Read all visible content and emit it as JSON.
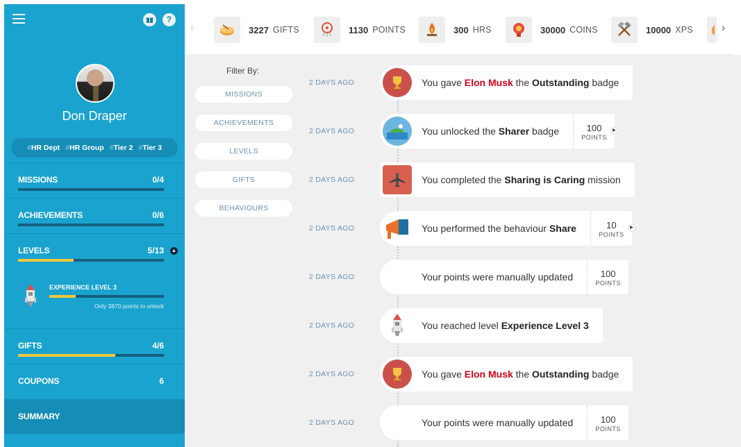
{
  "sidebar": {
    "user_name": "Don Draper",
    "tags": [
      "HR Dept",
      "HR Group",
      "Tier 2",
      "Tier 3"
    ],
    "tag_hash": "#",
    "help_icon": "?",
    "nav": [
      {
        "label": "MISSIONS",
        "value": "0/4",
        "progress": 0
      },
      {
        "label": "ACHIEVEMENTS",
        "value": "0/6",
        "progress": 0
      },
      {
        "label": "LEVELS",
        "value": "5/13",
        "progress": 0.38
      },
      {
        "label": "GIFTS",
        "value": "4/6",
        "progress": 0.667
      },
      {
        "label": "COUPONS",
        "value": "6"
      },
      {
        "label": "SUMMARY"
      }
    ],
    "level_detail": {
      "title": "EXPERIENCE LEVEL 3",
      "progress": 0.23,
      "hint": "Only 3870 points to unlock"
    }
  },
  "stats": [
    {
      "num": "3227",
      "unit": "GIFTS",
      "icon": "gift-drum-icon"
    },
    {
      "num": "1130",
      "unit": "POINTS",
      "icon": "dreamcatcher-icon"
    },
    {
      "num": "300",
      "unit": "HRS",
      "icon": "campfire-icon"
    },
    {
      "num": "30000",
      "unit": "COINS",
      "icon": "medal-icon"
    },
    {
      "num": "10000",
      "unit": "XPS",
      "icon": "crossed-tools-icon"
    }
  ],
  "filter": {
    "title": "Filter By:",
    "buttons": [
      "MISSIONS",
      "ACHIEVEMENTS",
      "LEVELS",
      "GIFTS",
      "BEHAVIOURS"
    ]
  },
  "feed": [
    {
      "time": "2 DAYS AGO",
      "icon": "trophy-icon",
      "pre": "You gave ",
      "red": "Elon Musk",
      "mid": " the ",
      "bold": "Outstanding",
      "post": " badge"
    },
    {
      "time": "2 DAYS AGO",
      "icon": "island-icon",
      "pre": "You unlocked the ",
      "bold": "Sharer",
      "post": " badge",
      "points": "100",
      "points_unit": "POINTS"
    },
    {
      "time": "2 DAYS AGO",
      "icon": "airplane-icon",
      "pre": "You completed the ",
      "bold": "Sharing is Caring",
      "post": " mission"
    },
    {
      "time": "2 DAYS AGO",
      "icon": "megaphone-icon",
      "pre": "You performed the behaviour ",
      "bold": "Share",
      "post": "",
      "points": "10",
      "points_unit": "POINTS"
    },
    {
      "time": "2 DAYS AGO",
      "icon": "none",
      "pre": "Your points were manually updated",
      "points": "100",
      "points_unit": "POINTS"
    },
    {
      "time": "2 DAYS AGO",
      "icon": "rocket-icon",
      "pre": "You reached level ",
      "bold": "Experience Level 3",
      "post": ""
    },
    {
      "time": "2 DAYS AGO",
      "icon": "trophy-icon",
      "pre": "You gave ",
      "red": "Elon Musk",
      "mid": " the ",
      "bold": "Outstanding",
      "post": " badge"
    },
    {
      "time": "2 DAYS AGO",
      "icon": "none",
      "pre": "Your points were manually updated",
      "points": "100",
      "points_unit": "POINTS"
    }
  ],
  "colors": {
    "sidebar": "#1aa3cf",
    "accent": "#f2c73a",
    "name_highlight": "#d0021b"
  }
}
